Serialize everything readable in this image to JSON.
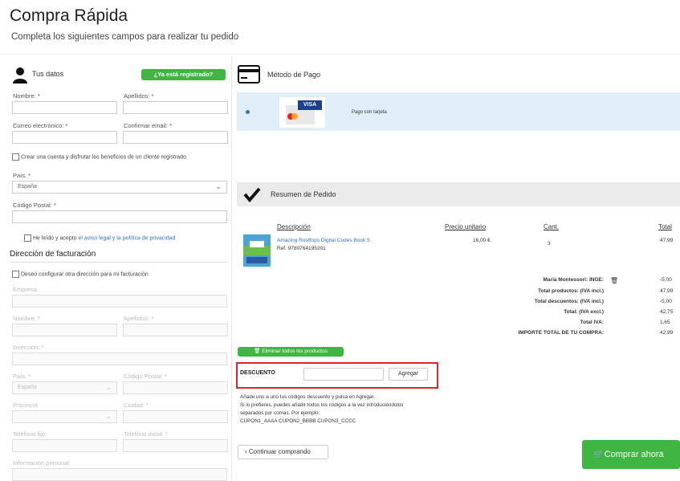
{
  "header": {
    "title": "Compra Rápida",
    "subtitle": "Completa los siguientes campos para realizar tu pedido"
  },
  "left": {
    "your_data": "Tus datos",
    "already_registered": "¿Ya está registrado?",
    "name_label": "Nombre: *",
    "surname_label": "Apellidos: *",
    "email_label": "Correo electrónico: *",
    "confirm_email_label": "Confirmar email: *",
    "create_account_text": "Crear una cuenta y disfrutar los beneficios de un cliente registrado.",
    "country_label": "País: *",
    "country_value": "España",
    "postal_label": "Código Postal: *",
    "legal_prefix": "He leído y acepto",
    "legal_link": "el aviso legal y la política de privacidad",
    "billing_title": "Dirección de facturación",
    "billing_check": "Deseo configurar otra dirección para mi facturación",
    "billing_company": "Empresa",
    "billing_name": "Nombre: *",
    "billing_surname": "Apellidos: *",
    "billing_address": "Dirección: *",
    "billing_country": "País: *",
    "billing_postal": "Código Postal: *",
    "billing_country_value": "España",
    "billing_province": "Provincia",
    "billing_city": "Ciudad: *",
    "billing_phone": "Teléfono fijo",
    "billing_mobile": "Teléfono móvil: *",
    "billing_info": "Información personal"
  },
  "payment": {
    "title": "Método de Pago",
    "option_label": "Pago con tarjeta",
    "card_brand": "VISA"
  },
  "summary": {
    "title": "Resumen de Pedido",
    "col_desc": "Descripción",
    "col_price": "Precio unitario",
    "col_qty": "Cant.",
    "col_total": "Total",
    "product_name": "Amazing Rooftops Digital Codes Book 5",
    "product_ref": "Ref. 9780764195201",
    "product_price": "16,00 €",
    "product_qty": "3",
    "product_total": "47,99",
    "totals": [
      {
        "label": "Maria Montessori: INGE:",
        "value": "-5,00"
      },
      {
        "label": "Total productos: (IVA incl.)",
        "value": "47,99"
      },
      {
        "label": "Total descuentos: (IVA incl.)",
        "value": "-5,00"
      },
      {
        "label": "Total: (IVA excl.)",
        "value": "42,75"
      },
      {
        "label": "Total IVA:",
        "value": "1,65"
      },
      {
        "label": "IMPORTE TOTAL DE TU COMPRA:",
        "value": "42,99"
      }
    ],
    "delete_all": "Eliminar todos los productos",
    "discount_label": "DESCUENTO",
    "add_button": "Agregar",
    "help_1": "Añade uno a uno tus códigos descuento y pulsa en Agregar.",
    "help_2": "Si lo prefieres, puedes añadir todos los códigos a la vez introduciéndolos",
    "help_3": "separados por comas. Por ejemplo:",
    "help_4": "CUPON1_AAAA CUPON2_BBBB CUPON3_CCCC",
    "continue": "Continuar comprando",
    "buy_now": "Comprar ahora"
  },
  "colors": {
    "accent_green": "#3fb542",
    "highlight_red": "#d9262e",
    "payment_bg": "#dfeef7"
  }
}
